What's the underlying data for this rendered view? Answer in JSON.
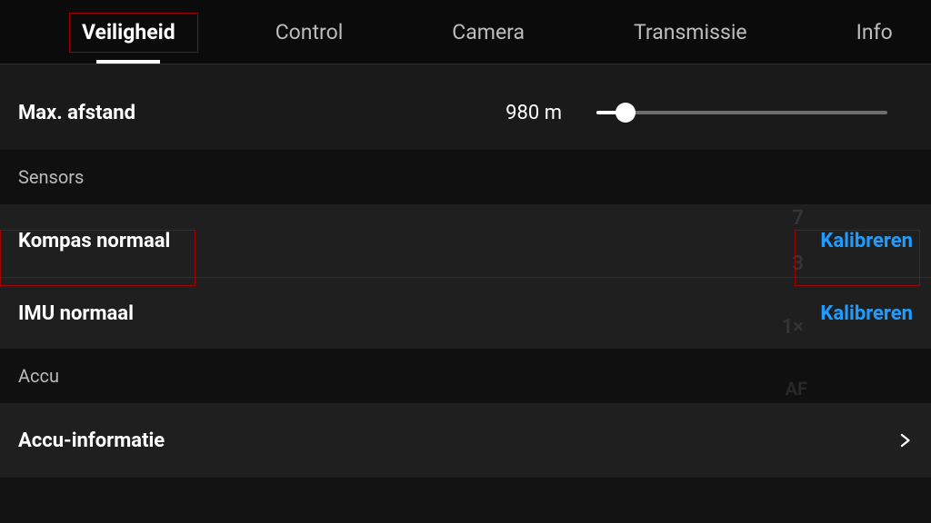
{
  "tabs": [
    {
      "label": "Veiligheid",
      "active": true
    },
    {
      "label": "Control",
      "active": false
    },
    {
      "label": "Camera",
      "active": false
    },
    {
      "label": "Transmissie",
      "active": false
    },
    {
      "label": "Info",
      "active": false
    }
  ],
  "max_distance": {
    "label": "Max. afstand",
    "value_display": "980 m",
    "slider_fill_pct": 10
  },
  "sections": {
    "sensors_header": "Sensors",
    "compass": {
      "label": "Kompas normaal",
      "action": "Kalibreren"
    },
    "imu": {
      "label": "IMU normaal",
      "action": "Kalibreren"
    },
    "battery_header": "Accu",
    "battery_info": {
      "label": "Accu-informatie"
    }
  },
  "bg_markers": {
    "m7": "7",
    "m3": "3",
    "m1x": "1×",
    "af": "AF"
  }
}
